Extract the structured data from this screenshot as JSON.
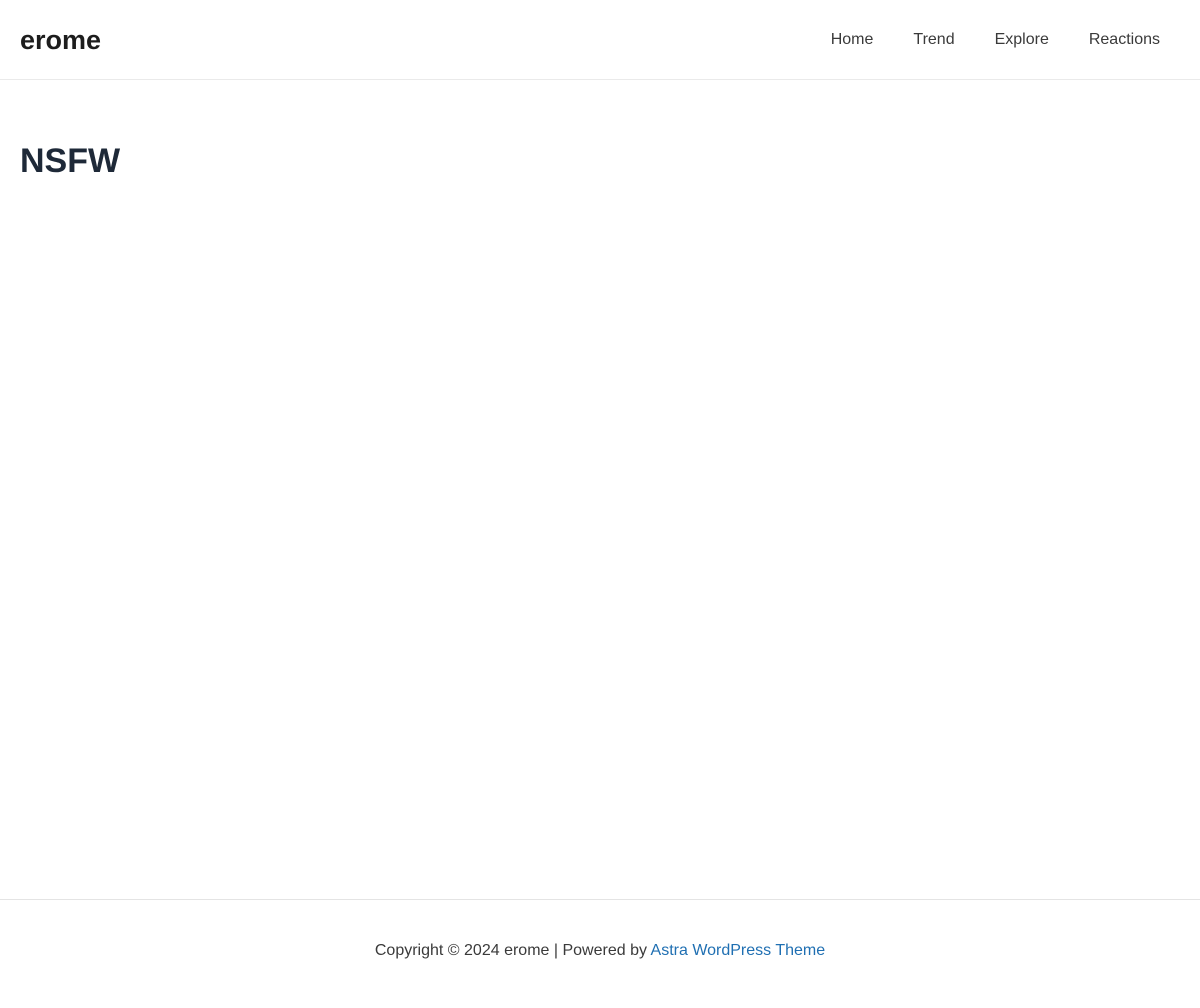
{
  "header": {
    "site_title": "erome",
    "nav": [
      {
        "label": "Home"
      },
      {
        "label": "Trend"
      },
      {
        "label": "Explore"
      },
      {
        "label": "Reactions"
      }
    ]
  },
  "main": {
    "page_title": "NSFW"
  },
  "footer": {
    "copyright_text": "Copyright © 2024 erome | Powered by",
    "theme_link": "Astra WordPress Theme"
  },
  "colors": {
    "title_text": "#1e2938",
    "nav_text": "#3a3a3a",
    "link": "#1f6fb2",
    "divider": "#eaeaea"
  }
}
